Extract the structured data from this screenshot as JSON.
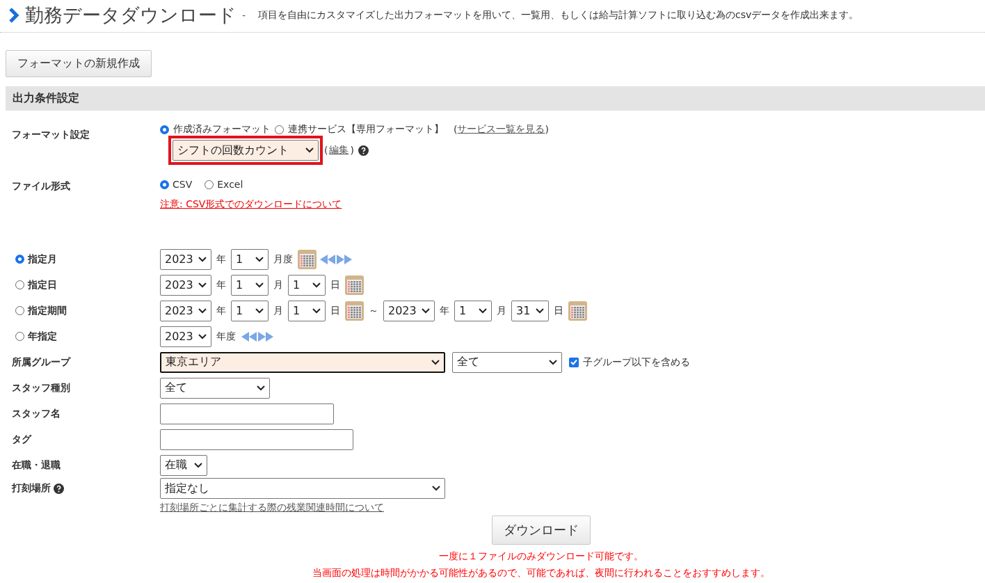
{
  "header": {
    "title": "勤務データダウンロード",
    "separator": "-",
    "description": "項目を自由にカスタマイズした出力フォーマットを用いて、一覧用、もしくは給与計算ソフトに取り込む為のcsvデータを作成出来ます。"
  },
  "new_format_button": "フォーマットの新規作成",
  "section_title": "出力条件設定",
  "format_setting": {
    "label": "フォーマット設定",
    "options": [
      {
        "label": "作成済みフォーマット",
        "selected": true
      },
      {
        "label": "連携サービス【専用フォーマット】",
        "selected": false
      }
    ],
    "service_link": "サービス一覧を見る",
    "format_select": "シフトの回数カウント",
    "highlighted": true,
    "edit_link": "編集",
    "open_paren": "(",
    "close_paren": ")"
  },
  "file_format": {
    "label": "ファイル形式",
    "options": [
      {
        "label": "CSV",
        "selected": true
      },
      {
        "label": "Excel",
        "selected": false
      }
    ],
    "warning_link": "注意: CSV形式でのダウンロードについて"
  },
  "periods": [
    {
      "label": "指定月",
      "selected": true,
      "parts": [
        {
          "kind": "select",
          "value": "2023"
        },
        {
          "kind": "unit",
          "text": "年"
        },
        {
          "kind": "select",
          "value": "1"
        },
        {
          "kind": "unit",
          "text": "月度"
        },
        {
          "kind": "calendar"
        },
        {
          "kind": "arrows"
        }
      ]
    },
    {
      "label": "指定日",
      "selected": false,
      "parts": [
        {
          "kind": "select",
          "value": "2023"
        },
        {
          "kind": "unit",
          "text": "年"
        },
        {
          "kind": "select",
          "value": "1"
        },
        {
          "kind": "unit",
          "text": "月"
        },
        {
          "kind": "select",
          "value": "1"
        },
        {
          "kind": "unit",
          "text": "日"
        },
        {
          "kind": "calendar"
        }
      ]
    },
    {
      "label": "指定期間",
      "selected": false,
      "parts": [
        {
          "kind": "select",
          "value": "2023"
        },
        {
          "kind": "unit",
          "text": "年"
        },
        {
          "kind": "select",
          "value": "1"
        },
        {
          "kind": "unit",
          "text": "月"
        },
        {
          "kind": "select",
          "value": "1"
        },
        {
          "kind": "unit",
          "text": "日"
        },
        {
          "kind": "calendar"
        },
        {
          "kind": "unit",
          "text": "～"
        },
        {
          "kind": "select",
          "value": "2023"
        },
        {
          "kind": "unit",
          "text": "年"
        },
        {
          "kind": "select",
          "value": "1"
        },
        {
          "kind": "unit",
          "text": "月"
        },
        {
          "kind": "select",
          "value": "31"
        },
        {
          "kind": "unit",
          "text": "日"
        },
        {
          "kind": "calendar"
        }
      ]
    },
    {
      "label": "年指定",
      "selected": false,
      "parts": [
        {
          "kind": "select",
          "value": "2023"
        },
        {
          "kind": "unit",
          "text": "年度"
        },
        {
          "kind": "arrows"
        }
      ]
    }
  ],
  "group": {
    "label": "所属グループ",
    "select": "東京エリア",
    "focused": true,
    "sub_select": "全て",
    "include_children": {
      "label": "子グループ以下を含める",
      "checked": true
    }
  },
  "staff_type": {
    "label": "スタッフ種別",
    "select": "全て"
  },
  "staff_name": {
    "label": "スタッフ名"
  },
  "tag": {
    "label": "タグ"
  },
  "employment": {
    "label": "在職・退職",
    "select": "在職"
  },
  "punch_location": {
    "label": "打刻場所",
    "select": "指定なし",
    "link": "打刻場所ごとに集計する際の残業関連時間について"
  },
  "download_button": "ダウンロード",
  "notes": [
    "一度に１ファイルのみダウンロード可能です。",
    "当画面の処理は時間がかかる可能性があるので、可能であれば、夜間に行われることをおすすめします。"
  ]
}
